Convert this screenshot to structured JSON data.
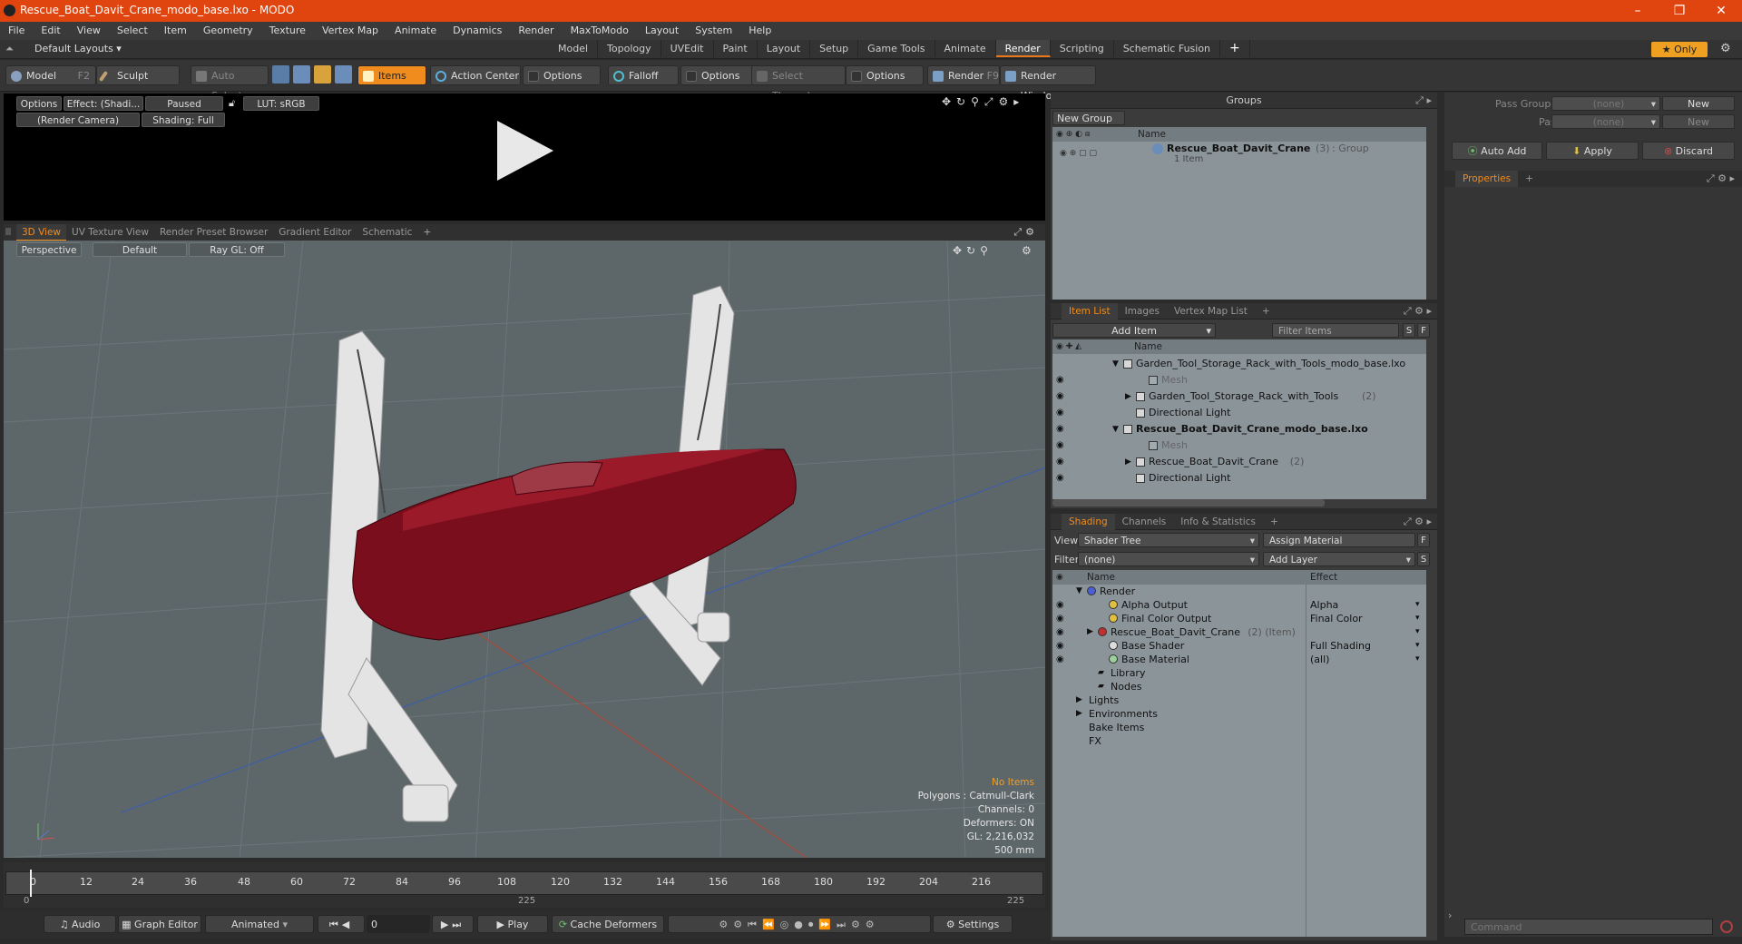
{
  "window": {
    "title": "Rescue_Boat_Davit_Crane_modo_base.lxo - MODO",
    "min": "–",
    "max": "❐",
    "close": "✕"
  },
  "menu": [
    "File",
    "Edit",
    "View",
    "Select",
    "Item",
    "Geometry",
    "Texture",
    "Vertex Map",
    "Animate",
    "Dynamics",
    "Render",
    "MaxToModo",
    "Layout",
    "System",
    "Help"
  ],
  "layouts": {
    "dropdown": "Default Layouts ▾",
    "tabs": [
      "Model",
      "Topology",
      "UVEdit",
      "Paint",
      "Layout",
      "Setup",
      "Game Tools",
      "Animate",
      "Render",
      "Scripting",
      "Schematic Fusion"
    ],
    "active": "Render",
    "add": "+",
    "only": "★ Only"
  },
  "toolbar": {
    "model": "Model",
    "model_key": "F2",
    "sculpt": "Sculpt",
    "auto_select": "Auto Select",
    "items": "Items",
    "action_center": "Action Center",
    "options1": "Options",
    "falloff": "Falloff",
    "options2": "Options",
    "select_through": "Select Through",
    "options3": "Options",
    "render": "Render",
    "render_key": "F9",
    "render_window": "Render Window"
  },
  "preview": {
    "options": "Options",
    "effect": "Effect: (Shadi...",
    "paused": "Paused",
    "lut": "LUT: sRGB",
    "camera": "(Render Camera)",
    "shading": "Shading: Full"
  },
  "viewtabs": [
    "3D View",
    "UV Texture View",
    "Render Preset Browser",
    "Gradient Editor",
    "Schematic"
  ],
  "viewport": {
    "perspective": "Perspective",
    "default": "Default",
    "raygl": "Ray GL: Off",
    "no_items": "No Items",
    "polygons": "Polygons : Catmull-Clark",
    "channels": "Channels: 0",
    "deformers": "Deformers: ON",
    "gl": "GL: 2,216,032",
    "scale": "500 mm"
  },
  "timeline": {
    "ticks": [
      "0",
      "12",
      "24",
      "36",
      "48",
      "60",
      "72",
      "84",
      "96",
      "108",
      "120",
      "132",
      "144",
      "156",
      "168",
      "180",
      "192",
      "204",
      "216"
    ],
    "start": "0",
    "mid": "225",
    "end": "225"
  },
  "bottom": {
    "audio": "Audio",
    "graph_editor": "Graph Editor",
    "animated": "Animated",
    "frame": "0",
    "play": "Play",
    "cache": "Cache Deformers",
    "settings": "Settings"
  },
  "groups": {
    "title": "Groups",
    "new_group": "New Group",
    "col_name": "Name",
    "row_name": "Rescue_Boat_Davit_Crane",
    "row_count": "(3)",
    "row_type": ": Group",
    "row_sub": "1 Item"
  },
  "passes": {
    "pass_groups": "Pass Groups",
    "passes": "Passes",
    "none1": "(none)",
    "none2": "(none)",
    "new1": "New",
    "new2": "New",
    "auto_add": "Auto Add",
    "apply": "Apply",
    "discard": "Discard",
    "properties": "Properties",
    "add": "+"
  },
  "itemlist": {
    "tabs": [
      "Item List",
      "Images",
      "Vertex Map List"
    ],
    "add_item": "Add Item",
    "filter": "Filter Items",
    "s": "S",
    "f": "F",
    "col_name": "Name",
    "rows": [
      {
        "text": "Garden_Tool_Storage_Rack_with_Tools_modo_base.lxo",
        "indent": 0,
        "arrow": "▼",
        "bold": false,
        "dim": false,
        "count": ""
      },
      {
        "text": "Mesh",
        "indent": 2,
        "arrow": "",
        "bold": false,
        "dim": true,
        "count": ""
      },
      {
        "text": "Garden_Tool_Storage_Rack_with_Tools",
        "indent": 1,
        "arrow": "▶",
        "bold": false,
        "dim": false,
        "count": "(2)"
      },
      {
        "text": "Directional Light",
        "indent": 1,
        "arrow": "",
        "bold": false,
        "dim": false,
        "count": ""
      },
      {
        "text": "Rescue_Boat_Davit_Crane_modo_base.lxo",
        "indent": 0,
        "arrow": "▼",
        "bold": true,
        "dim": false,
        "count": ""
      },
      {
        "text": "Mesh",
        "indent": 2,
        "arrow": "",
        "bold": false,
        "dim": true,
        "count": ""
      },
      {
        "text": "Rescue_Boat_Davit_Crane",
        "indent": 1,
        "arrow": "▶",
        "bold": false,
        "dim": false,
        "count": "(2)"
      },
      {
        "text": "Directional Light",
        "indent": 1,
        "arrow": "",
        "bold": false,
        "dim": false,
        "count": ""
      }
    ]
  },
  "shading": {
    "tabs": [
      "Shading",
      "Channels",
      "Info & Statistics"
    ],
    "view_label": "View",
    "view_value": "Shader Tree",
    "assign": "Assign Material",
    "filter_label": "Filter",
    "filter_value": "(none)",
    "add_layer": "Add Layer",
    "f": "F",
    "s": "S",
    "col_name": "Name",
    "col_effect": "Effect",
    "rows": [
      {
        "text": "Render",
        "effect": "",
        "indent": 0,
        "eye": false,
        "arrow": "▼",
        "color": "#4a5fd6",
        "extra": ""
      },
      {
        "text": "Alpha Output",
        "effect": "Alpha",
        "indent": 2,
        "eye": true,
        "arrow": "",
        "color": "#e0c040",
        "extra": ""
      },
      {
        "text": "Final Color Output",
        "effect": "Final Color",
        "indent": 2,
        "eye": true,
        "arrow": "",
        "color": "#e0c040",
        "extra": ""
      },
      {
        "text": "Rescue_Boat_Davit_Crane",
        "effect": "",
        "indent": 1,
        "eye": true,
        "arrow": "▶",
        "color": "#c03030",
        "extra": "(2) (Item)"
      },
      {
        "text": "Base Shader",
        "effect": "Full Shading",
        "indent": 2,
        "eye": true,
        "arrow": "",
        "color": "#dddddd",
        "extra": ""
      },
      {
        "text": "Base Material",
        "effect": "(all)",
        "indent": 2,
        "eye": true,
        "arrow": "",
        "color": "#9ad09a",
        "extra": ""
      },
      {
        "text": "Library",
        "effect": "",
        "indent": 1,
        "eye": false,
        "arrow": "",
        "color": "",
        "extra": ""
      },
      {
        "text": "Nodes",
        "effect": "",
        "indent": 1,
        "eye": false,
        "arrow": "",
        "color": "",
        "extra": ""
      },
      {
        "text": "Lights",
        "effect": "",
        "indent": 0,
        "eye": false,
        "arrow": "▶",
        "color": "",
        "extra": ""
      },
      {
        "text": "Environments",
        "effect": "",
        "indent": 0,
        "eye": false,
        "arrow": "▶",
        "color": "",
        "extra": ""
      },
      {
        "text": "Bake Items",
        "effect": "",
        "indent": 0,
        "eye": false,
        "arrow": "",
        "color": "",
        "extra": ""
      },
      {
        "text": "FX",
        "effect": "",
        "indent": 0,
        "eye": false,
        "arrow": "",
        "color": "",
        "extra": ""
      }
    ]
  },
  "command": {
    "placeholder": "Command"
  }
}
